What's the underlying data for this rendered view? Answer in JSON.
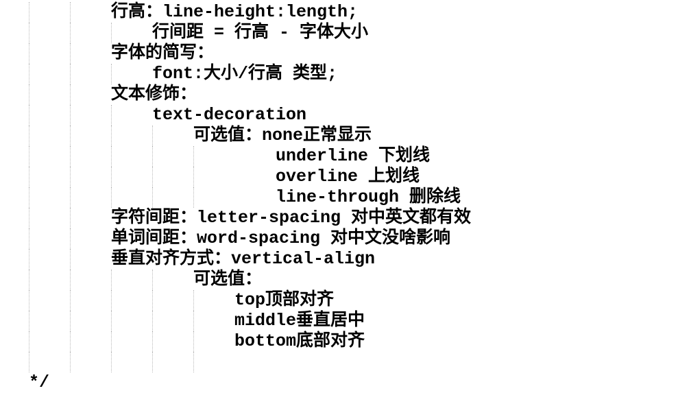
{
  "lines": [
    {
      "level": 2,
      "text": "行高：line-height:length;"
    },
    {
      "level": 3,
      "text": "行间距 = 行高 - 字体大小"
    },
    {
      "level": 2,
      "text": "字体的简写："
    },
    {
      "level": 3,
      "text": "font:大小/行高 类型;"
    },
    {
      "level": 2,
      "text": "文本修饰："
    },
    {
      "level": 3,
      "text": "text-decoration"
    },
    {
      "level": 4,
      "text": "可选值：none正常显示"
    },
    {
      "level": 6,
      "text": "underline 下划线"
    },
    {
      "level": 6,
      "text": "overline 上划线"
    },
    {
      "level": 6,
      "text": "line-through 删除线"
    },
    {
      "level": 2,
      "text": "字符间距：letter-spacing 对中英文都有效"
    },
    {
      "level": 2,
      "text": "单词间距：word-spacing 对中文没啥影响"
    },
    {
      "level": 2,
      "text": "垂直对齐方式：vertical-align"
    },
    {
      "level": 4,
      "text": "可选值："
    },
    {
      "level": 5,
      "text": "top顶部对齐"
    },
    {
      "level": 5,
      "text": "middle垂直居中"
    },
    {
      "level": 5,
      "text": "bottom底部对齐"
    },
    {
      "level": 5,
      "text": ""
    },
    {
      "level": 0,
      "text": "*/"
    }
  ]
}
